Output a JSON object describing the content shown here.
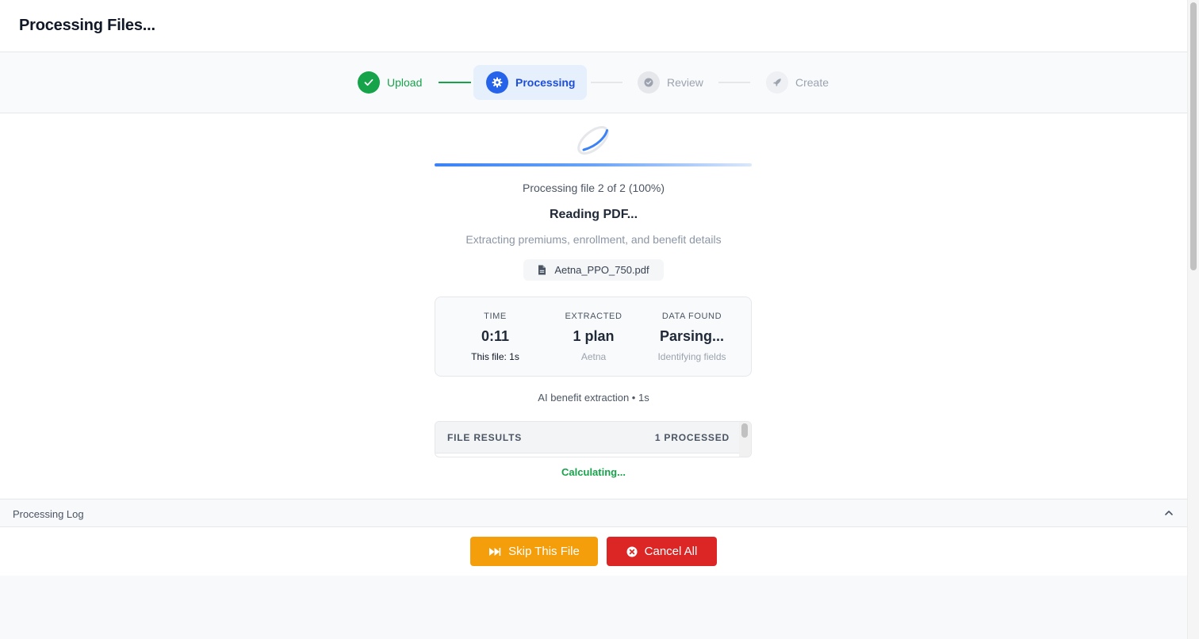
{
  "header": {
    "title": "Processing Files..."
  },
  "stepper": {
    "steps": [
      {
        "label": "Upload",
        "state": "complete",
        "icon": "check-icon"
      },
      {
        "label": "Processing",
        "state": "active",
        "icon": "gear-icon"
      },
      {
        "label": "Review",
        "state": "pending",
        "icon": "check-circle-icon"
      },
      {
        "label": "Create",
        "state": "pending",
        "icon": "rocket-icon"
      }
    ]
  },
  "progress": {
    "status": "Processing file 2 of 2 (100%)",
    "percent": 100,
    "stage_title": "Reading PDF...",
    "stage_detail": "Extracting premiums, enrollment, and benefit details",
    "current_file": "Aetna_PPO_750.pdf"
  },
  "stats": [
    {
      "label": "TIME",
      "value": "0:11",
      "sub": "This file: 1s"
    },
    {
      "label": "EXTRACTED",
      "value": "1 plan",
      "sub": "Aetna"
    },
    {
      "label": "DATA FOUND",
      "value": "Parsing...",
      "sub": "Identifying fields"
    }
  ],
  "ai_line": "AI benefit extraction • 1s",
  "results": {
    "title": "FILE RESULTS",
    "count": "1 PROCESSED"
  },
  "calculating": "Calculating...",
  "log": {
    "label": "Processing Log"
  },
  "actions": {
    "skip_label": "Skip This File",
    "cancel_label": "Cancel All"
  },
  "colors": {
    "success": "#16a34a",
    "primary": "#2563eb",
    "warning": "#f59e0b",
    "danger": "#dc2626"
  }
}
